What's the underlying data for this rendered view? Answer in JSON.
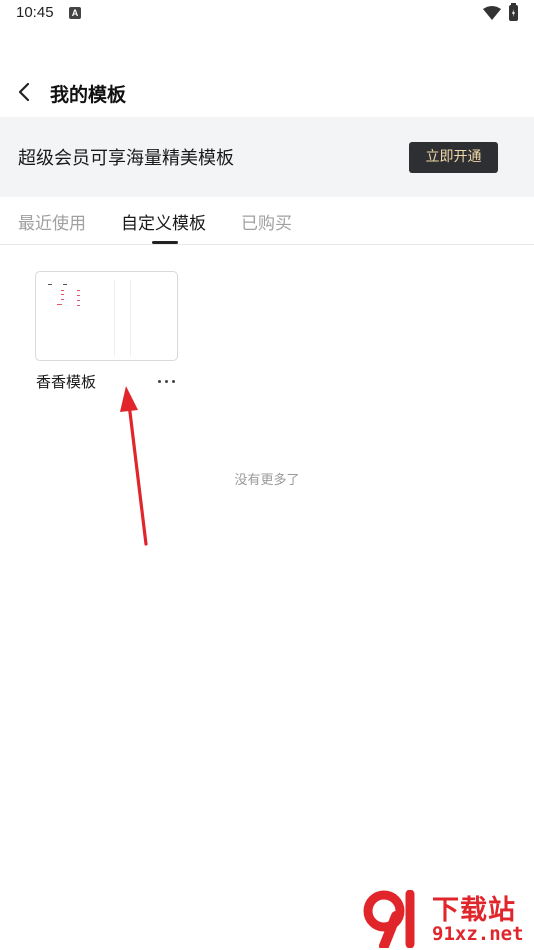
{
  "status_bar": {
    "time": "10:45",
    "notification_icon": "a-letter-icon",
    "wifi_icon": "wifi-icon",
    "battery_icon": "battery-charging-icon"
  },
  "nav": {
    "back_icon": "back-arrow-icon",
    "title": "我的模板"
  },
  "vip_banner": {
    "text": "超级会员可享海量精美模板",
    "button_label": "立即开通",
    "button_color": "#2d2f33",
    "button_text_color": "#f1d8a6"
  },
  "tabs": [
    {
      "label": "最近使用",
      "active": false
    },
    {
      "label": "自定义模板",
      "active": true
    },
    {
      "label": "已购买",
      "active": false
    }
  ],
  "templates": [
    {
      "name": "香香模板",
      "more_icon": "more-horizontal-icon"
    }
  ],
  "list_end_text": "没有更多了",
  "annotation": {
    "arrow_color": "#e0262b"
  },
  "watermark": {
    "title": "下载站",
    "url": "91xz.net"
  }
}
